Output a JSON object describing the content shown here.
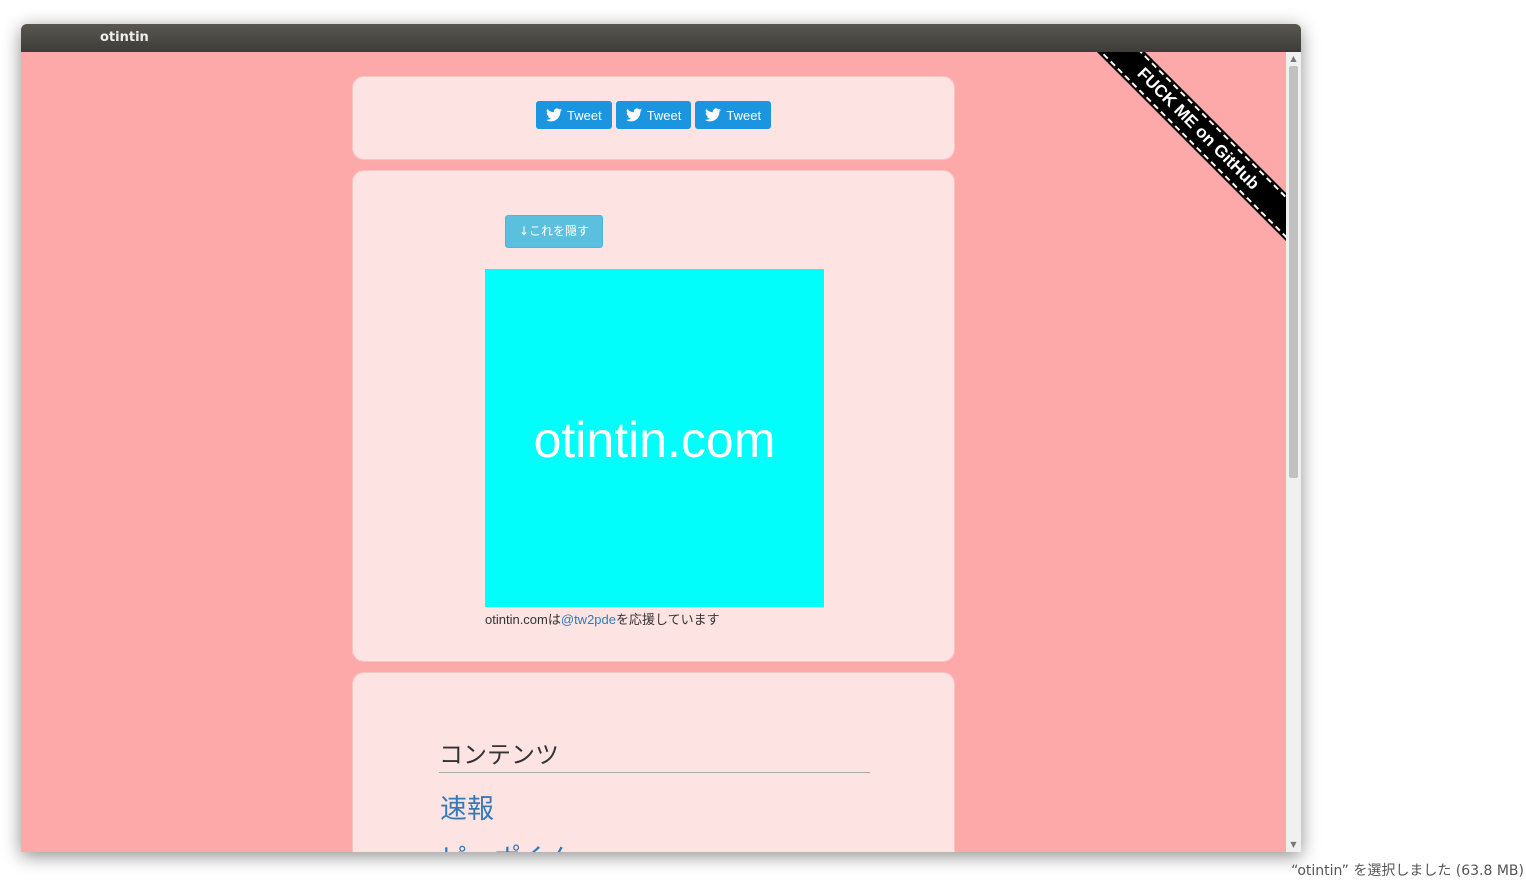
{
  "window": {
    "title": "otintin"
  },
  "tweet_buttons": [
    {
      "label": "Tweet"
    },
    {
      "label": "Tweet"
    },
    {
      "label": "Tweet"
    }
  ],
  "banner": {
    "hide_label": "↓これを隠す",
    "image_text": "otintin.com",
    "support_prefix": "otintin.comは",
    "support_link": "@tw2pde",
    "support_suffix": "を応援しています"
  },
  "contents": {
    "heading": "コンテンツ",
    "links": [
      "速報",
      "ピーポくん"
    ]
  },
  "ribbon": {
    "label": "FUCK ME on GitHub"
  },
  "statusbar": {
    "text": "“otintin” を選択しました (63.8 MB)"
  },
  "colors": {
    "page_bg": "#fea9a9",
    "panel_bg": "#fee3e3",
    "tweet_blue": "#1b95e0",
    "info_button": "#5bc0de",
    "banner_cyan": "#02fefb",
    "link": "#337ab7"
  },
  "icons": {
    "tweet": "twitter-bird-icon"
  }
}
